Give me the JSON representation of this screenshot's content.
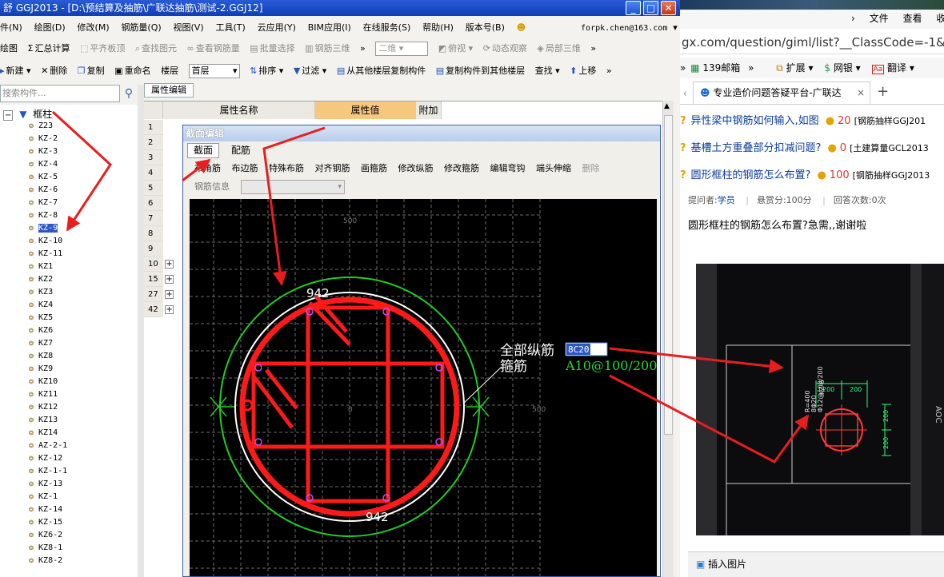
{
  "app": {
    "title": "GGJ2013 - [D:\\预结算及抽筋\\广联达抽筋\\测试-2.GGJ12]",
    "menus": [
      "件(N)",
      "绘图(D)",
      "修改(M)",
      "钢筋量(Q)",
      "视图(V)",
      "工具(T)",
      "云应用(Y)",
      "BIM应用(I)",
      "在线服务(S)",
      "帮助(H)",
      "版本号(B)"
    ],
    "user_email": "forpk.chen@163.com",
    "toolbar1": {
      "draw": "绘图",
      "sum": "汇总计算",
      "flat_slab": "平齐板顶",
      "find_elem": "查找图元",
      "view_rebar": "查看钢筋量",
      "batch_select": "批量选择",
      "rebar_3d": "钢筋三维",
      "view_mode": "二维",
      "top_view": "俯视",
      "dynamic_view": "动态观察",
      "local_3d": "局部三维"
    },
    "toolbar2": {
      "new": "新建",
      "delete": "删除",
      "copy": "复制",
      "rename": "重命名",
      "floor_label": "楼层",
      "floor_value": "首层",
      "sort": "排序",
      "filter": "过滤",
      "copy_from_floor": "从其他楼层复制构件",
      "copy_to_floor": "复制构件到其他楼层",
      "find": "查找",
      "move_up": "上移"
    },
    "search_placeholder": "搜索构件...",
    "tree_root": "框柱",
    "tree_items": [
      "Z23",
      "KZ-2",
      "KZ-3",
      "KZ-4",
      "KZ-5",
      "KZ-6",
      "KZ-7",
      "KZ-8",
      "KZ-9",
      "KZ-10",
      "KZ-11",
      "KZ1",
      "KZ2",
      "KZ3",
      "KZ4",
      "KZ5",
      "KZ6",
      "KZ7",
      "KZ8",
      "KZ9",
      "KZ10",
      "KZ11",
      "KZ12",
      "KZ13",
      "KZ14",
      "AZ-2-1",
      "KZ-12",
      "KZ-1-1",
      "KZ-13",
      "KZ-1",
      "KZ-14",
      "KZ-15",
      "KZ6-2",
      "KZ8-1",
      "KZ8-2"
    ],
    "selected_item": "KZ-9",
    "prop_tab": "属性编辑",
    "prop_headers": {
      "name": "属性名称",
      "value": "属性值",
      "extra": "附加"
    },
    "prop_rows": [
      "1",
      "2",
      "3",
      "4",
      "5",
      "6",
      "7",
      "8",
      "9",
      "10",
      "15",
      "27",
      "42"
    ]
  },
  "dialog": {
    "title": "截面编辑",
    "tabs": [
      "截面",
      "配筋"
    ],
    "tools": [
      "布角筋",
      "布边筋",
      "特殊布筋",
      "对齐钢筋",
      "画箍筋",
      "修改纵筋",
      "修改箍筋",
      "编辑弯钩",
      "端头伸缩",
      "删除"
    ],
    "rebar_info": "钢筋信息",
    "dims": {
      "top": "942",
      "bottom": "942",
      "grid_top": "500",
      "grid_right": "500",
      "grid_center": "0"
    },
    "labels": {
      "longitudinal": "全部纵筋",
      "stirrup": "箍筋"
    },
    "longitudinal_value": "8C20",
    "stirrup_value": "A10@100/200"
  },
  "browser": {
    "menu": [
      "文件",
      "查看",
      "收"
    ],
    "url": "gx.com/question/giml/list?__ClassCode=-1&__I",
    "favs": {
      "mail": "139邮箱",
      "ext": "扩展",
      "bank": "网银",
      "translate": "翻译"
    },
    "tab_title": "专业造价问题答疑平台-广联达",
    "questions": [
      {
        "title": "异性梁中钢筋如何输入,如图",
        "points": "20",
        "category": "[钢筋抽样GGJ201"
      },
      {
        "title": "基槽土方重叠部分扣减问题?",
        "points": "0",
        "category": "[土建算量GCL2013"
      },
      {
        "title": "圆形框柱的钢筋怎么布置?",
        "points": "100",
        "category": "[钢筋抽样GGJ2013"
      }
    ],
    "asker_label": "提问者:",
    "asker": "学员",
    "reward": "悬赏分:100分",
    "answers": "回答次数:0次",
    "question_text": "圆形框柱的钢筋怎么布置?急需,,谢谢啦",
    "insert_image": "插入图片"
  },
  "photo": {
    "labels": [
      "KZ-6",
      "R=400",
      "8Φ20",
      "Φ12@100/200"
    ],
    "dims": [
      "200",
      "200",
      "200",
      "200"
    ],
    "brand": "AOC"
  },
  "colors": {
    "rebar": "#ff1a1a",
    "cover": "#22cc22",
    "arrow": "#e81e1e",
    "selection": "#2b57c5"
  }
}
